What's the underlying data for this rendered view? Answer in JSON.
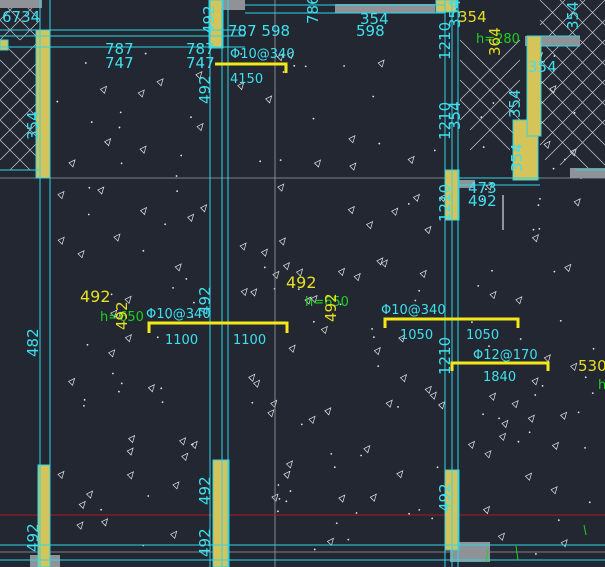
{
  "colors": {
    "background": "#222732",
    "wall_line": "#2fd6e6",
    "grid_line": "#9aa1aa",
    "wall_fill": "#8f9296",
    "column_fill": "#d4c45a",
    "rebar_bar": "#f4e81a",
    "dim_text": "#3fe0ee",
    "elev_text": "#e8df22",
    "green_text": "#1fd01f",
    "section_line": "#b1161a",
    "triangles": "#e6e6e6"
  },
  "labels": {
    "tl_6734": "6734",
    "tl_787": "787",
    "tl_747": "747",
    "tl_787b": "787",
    "tl_747b": "747",
    "tl_354_v": "354",
    "col_492_a": "492",
    "col_492_b": "492",
    "col_492_c": "492",
    "col_492_d": "492",
    "top_787_598": "787 598",
    "top_786": "786",
    "top_354": "354",
    "top_598": "598",
    "rebar_top": "Φ10@340",
    "span_4150": "4150",
    "elev_492_left": "492",
    "elev_492_mid": "492",
    "h_650_left": "h=650",
    "h_650_mid": "h=650",
    "rebar_left": "Φ10@340",
    "dim_1100_a": "1100",
    "dim_1100_b": "1100",
    "left_col_482": "482",
    "left_col_492": "492",
    "v492_mid": "492",
    "mid_col_492": "492",
    "right_1210_a": "1210",
    "right_354_a": "354",
    "right_1210_b": "1210",
    "right_1210_c": "1210",
    "right_1210_d": "1210",
    "right_354_b": "354",
    "right_473": "473",
    "right_492": "492",
    "rebar_right": "Φ10@340",
    "dim_1050_a": "1050",
    "dim_1050_b": "1050",
    "rebar_right2": "Φ12@170",
    "dim_1840": "1840",
    "tr_354": "354",
    "tr_h280": "h=280",
    "tr_364": "364",
    "tr_354b": "354",
    "tr_354c": "354",
    "tr_354d": "354",
    "tr_354e": "354",
    "far_right_530": "530",
    "far_right_h": "h",
    "bot_492_a": "492",
    "bot_492_b": "492"
  }
}
